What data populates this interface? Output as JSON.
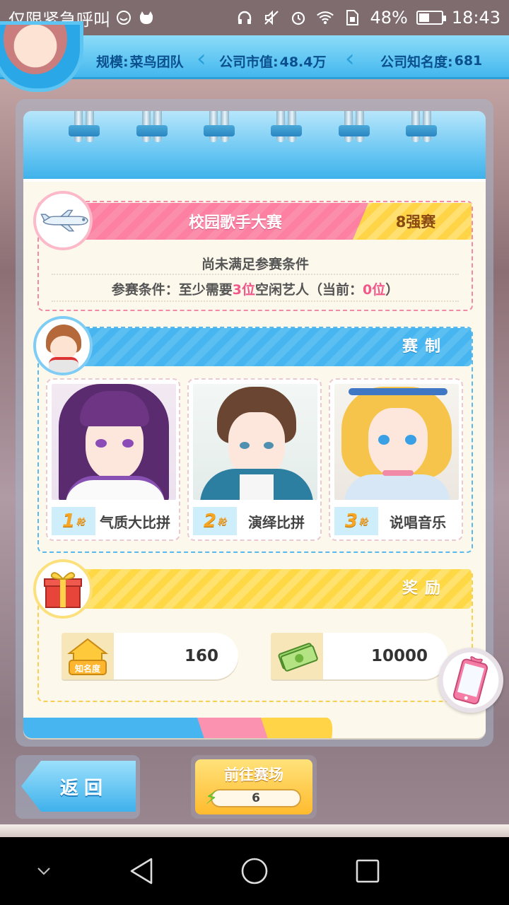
{
  "status_bar": {
    "carrier_text": "仅限紧急呼叫",
    "battery_percent": "48%",
    "battery_level": 0.48,
    "time": "18:43"
  },
  "top_info": {
    "scale_label": "规模:",
    "scale_value": "菜鸟团队",
    "market_label": "公司市值:",
    "market_value": "48.4万",
    "fame_label": "公司知名度:",
    "fame_value": "681"
  },
  "contest": {
    "title": "校园歌手大赛",
    "stage": "8强赛",
    "condition_status": "尚未满足参赛条件",
    "condition_prefix": "参赛条件：至少需要",
    "required_count": "3位",
    "condition_middle": "空闲艺人（当前：",
    "current_count": "0位",
    "condition_suffix": "）"
  },
  "rules": {
    "title": "赛制",
    "rounds": [
      {
        "rank": "1",
        "rank_suffix": "轮",
        "name": "气质大比拼"
      },
      {
        "rank": "2",
        "rank_suffix": "轮",
        "name": "演绎比拼"
      },
      {
        "rank": "3",
        "rank_suffix": "轮",
        "name": "说唱音乐"
      }
    ]
  },
  "rewards": {
    "title": "奖励",
    "fame_icon_label": "知名度",
    "fame_value": "160",
    "money_value": "10000"
  },
  "buttons": {
    "back": "返回",
    "go": "前往赛场",
    "energy": "6"
  },
  "colors": {
    "pink_banner": "#fd7fa2",
    "yellow_banner": "#ffd447",
    "blue_banner": "#47b5ef",
    "highlight": "#f2578a"
  }
}
